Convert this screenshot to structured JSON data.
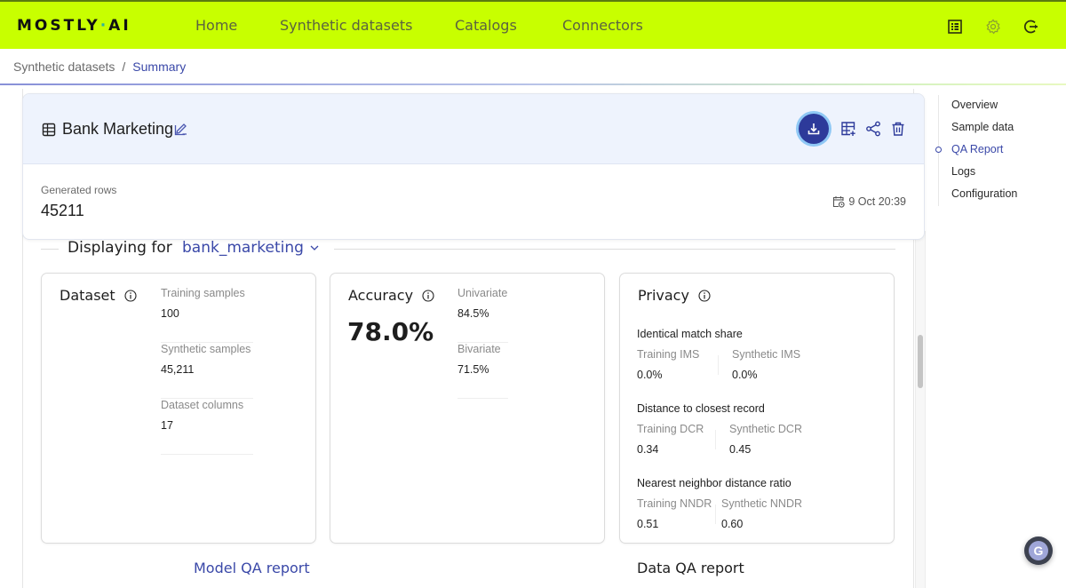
{
  "app": {
    "logo_left": "MOSTLY",
    "logo_dot": "·",
    "logo_right": "AI"
  },
  "nav": {
    "items": [
      {
        "label": "Home"
      },
      {
        "label": "Synthetic datasets"
      },
      {
        "label": "Catalogs"
      },
      {
        "label": "Connectors"
      }
    ],
    "icons": [
      "docs-icon",
      "gear-icon",
      "logout-icon"
    ]
  },
  "breadcrumb": {
    "parent": "Synthetic datasets",
    "separator": "/",
    "current": "Summary"
  },
  "dataset": {
    "title": "Bank Marketing",
    "generated_rows_label": "Generated rows",
    "generated_rows_value": "45211",
    "date": "9 Oct 20:39"
  },
  "colors": {
    "accent": "#c8ff00",
    "brand_blue": "#3a48a8",
    "download_button": "#2d3a9a"
  },
  "display": {
    "label": "Displaying for",
    "selected_table": "bank_marketing"
  },
  "cards": {
    "dataset": {
      "title": "Dataset",
      "metrics": [
        {
          "label": "Training samples",
          "value": "100"
        },
        {
          "label": "Synthetic samples",
          "value": "45,211"
        },
        {
          "label": "Dataset columns",
          "value": "17"
        }
      ]
    },
    "accuracy": {
      "title": "Accuracy",
      "overall": "78.0%",
      "metrics": [
        {
          "label": "Univariate",
          "value": "84.5%"
        },
        {
          "label": "Bivariate",
          "value": "71.5%"
        }
      ]
    },
    "privacy": {
      "title": "Privacy",
      "sections": [
        {
          "title": "Identical match share",
          "training_label": "Training IMS",
          "training_value": "0.0%",
          "synthetic_label": "Synthetic IMS",
          "synthetic_value": "0.0%"
        },
        {
          "title": "Distance to closest record",
          "training_label": "Training DCR",
          "training_value": "0.34",
          "synthetic_label": "Synthetic DCR",
          "synthetic_value": "0.45"
        },
        {
          "title": "Nearest neighbor distance ratio",
          "training_label": "Training NNDR",
          "training_value": "0.51",
          "synthetic_label": "Synthetic NNDR",
          "synthetic_value": "0.60"
        }
      ]
    }
  },
  "reports": {
    "model": "Model QA report",
    "data": "Data QA report"
  },
  "side_nav": {
    "items": [
      {
        "label": "Overview"
      },
      {
        "label": "Sample data"
      },
      {
        "label": "QA Report",
        "active": true
      },
      {
        "label": "Logs"
      },
      {
        "label": "Configuration"
      }
    ]
  },
  "fab": {
    "glyph": "G"
  }
}
